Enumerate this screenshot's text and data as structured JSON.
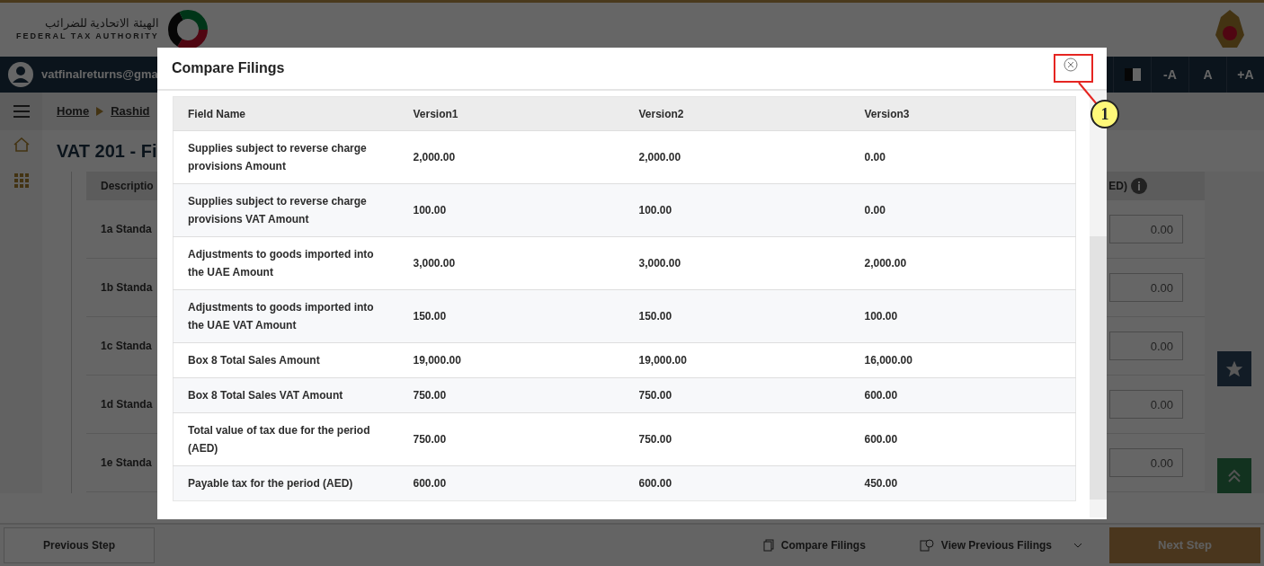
{
  "header": {
    "logo_arabic": "الهيئة الاتحادية للضرائب",
    "logo_english": "FEDERAL TAX AUTHORITY"
  },
  "user_bar": {
    "email": "vatfinalreturns@gma",
    "font_buttons": [
      "-A",
      "A",
      "+A"
    ]
  },
  "breadcrumb": [
    "Home",
    "Rashid"
  ],
  "page_title": "VAT 201 - Fi",
  "form_table": {
    "column_1": "Descriptio",
    "column_2": "ED)",
    "rows": [
      {
        "label": "1a Standa",
        "value": "0.00"
      },
      {
        "label": "1b Standa",
        "value": "0.00"
      },
      {
        "label": "1c Standa",
        "value": "0.00"
      },
      {
        "label": "1d Standa",
        "value": "0.00"
      },
      {
        "label": "1e Standa",
        "value": "0.00"
      }
    ]
  },
  "modal": {
    "title": "Compare Filings",
    "columns": [
      "Field Name",
      "Version1",
      "Version2",
      "Version3"
    ],
    "rows": [
      {
        "cells": [
          "Supplies subject to reverse charge provisions Amount",
          "2,000.00",
          "2,000.00",
          "0.00"
        ]
      },
      {
        "cells": [
          "Supplies subject to reverse charge provisions VAT Amount",
          "100.00",
          "100.00",
          "0.00"
        ]
      },
      {
        "cells": [
          "Adjustments to goods imported into the UAE Amount",
          "3,000.00",
          "3,000.00",
          "2,000.00"
        ]
      },
      {
        "cells": [
          "Adjustments to goods imported into the UAE VAT Amount",
          "150.00",
          "150.00",
          "100.00"
        ]
      },
      {
        "cells": [
          "Box 8 Total Sales Amount",
          "19,000.00",
          "19,000.00",
          "16,000.00"
        ]
      },
      {
        "cells": [
          "Box 8 Total Sales VAT Amount",
          "750.00",
          "750.00",
          "600.00"
        ]
      },
      {
        "cells": [
          "Total value of tax due for the period (AED)",
          "750.00",
          "750.00",
          "600.00"
        ]
      },
      {
        "cells": [
          "Payable tax for the period (AED)",
          "600.00",
          "600.00",
          "450.00"
        ]
      }
    ]
  },
  "annotation": {
    "number": "1"
  },
  "footer": {
    "previous": "Previous Step",
    "compare": "Compare Filings",
    "view_previous": "View Previous Filings",
    "next": "Next Step"
  }
}
